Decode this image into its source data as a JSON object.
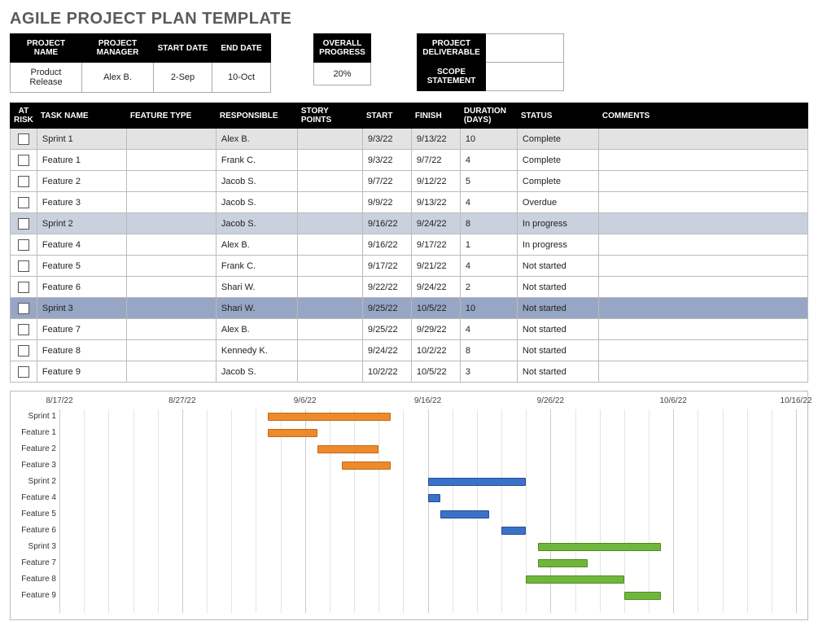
{
  "title": "AGILE PROJECT PLAN TEMPLATE",
  "meta": {
    "labels": {
      "project_name": "PROJECT NAME",
      "project_manager": "PROJECT MANAGER",
      "start_date": "START DATE",
      "end_date": "END DATE",
      "overall_progress": "OVERALL PROGRESS",
      "project_deliverable": "PROJECT DELIVERABLE",
      "scope_statement": "SCOPE STATEMENT"
    },
    "values": {
      "project_name": "Product Release",
      "project_manager": "Alex B.",
      "start_date": "2-Sep",
      "end_date": "10-Oct",
      "overall_progress": "20%",
      "project_deliverable": "",
      "scope_statement": ""
    }
  },
  "columns": {
    "at_risk": "AT RISK",
    "task_name": "TASK NAME",
    "feature_type": "FEATURE TYPE",
    "responsible": "RESPONSIBLE",
    "story_points": "STORY POINTS",
    "start": "START",
    "finish": "FINISH",
    "duration": "DURATION (DAYS)",
    "status": "STATUS",
    "comments": "COMMENTS"
  },
  "rows": [
    {
      "shade": 0,
      "task": "Sprint 1",
      "resp": "Alex B.",
      "start": "9/3/22",
      "finish": "9/13/22",
      "dur": "10",
      "status": "Complete"
    },
    {
      "task": "Feature 1",
      "resp": "Frank C.",
      "start": "9/3/22",
      "finish": "9/7/22",
      "dur": "4",
      "status": "Complete"
    },
    {
      "task": "Feature 2",
      "resp": "Jacob S.",
      "start": "9/7/22",
      "finish": "9/12/22",
      "dur": "5",
      "status": "Complete"
    },
    {
      "task": "Feature 3",
      "resp": "Jacob S.",
      "start": "9/9/22",
      "finish": "9/13/22",
      "dur": "4",
      "status": "Overdue"
    },
    {
      "shade": 1,
      "task": "Sprint 2",
      "resp": "Jacob S.",
      "start": "9/16/22",
      "finish": "9/24/22",
      "dur": "8",
      "status": "In progress"
    },
    {
      "task": "Feature 4",
      "resp": "Alex B.",
      "start": "9/16/22",
      "finish": "9/17/22",
      "dur": "1",
      "status": "In progress"
    },
    {
      "task": "Feature 5",
      "resp": "Frank C.",
      "start": "9/17/22",
      "finish": "9/21/22",
      "dur": "4",
      "status": "Not started"
    },
    {
      "task": "Feature 6",
      "resp": "Shari W.",
      "start": "9/22/22",
      "finish": "9/24/22",
      "dur": "2",
      "status": "Not started"
    },
    {
      "shade": 2,
      "task": "Sprint 3",
      "resp": "Shari W.",
      "start": "9/25/22",
      "finish": "10/5/22",
      "dur": "10",
      "status": "Not started"
    },
    {
      "task": "Feature 7",
      "resp": "Alex B.",
      "start": "9/25/22",
      "finish": "9/29/22",
      "dur": "4",
      "status": "Not started"
    },
    {
      "task": "Feature 8",
      "resp": "Kennedy K.",
      "start": "9/24/22",
      "finish": "10/2/22",
      "dur": "8",
      "status": "Not started"
    },
    {
      "task": "Feature 9",
      "resp": "Jacob S.",
      "start": "10/2/22",
      "finish": "10/5/22",
      "dur": "3",
      "status": "Not started"
    }
  ],
  "chart_data": {
    "type": "gantt",
    "x_axis": {
      "min": "8/17/22",
      "max": "10/16/22",
      "major_ticks": [
        "8/17/22",
        "8/27/22",
        "9/6/22",
        "9/16/22",
        "9/26/22",
        "10/6/22",
        "10/16/22"
      ]
    },
    "series_colors": {
      "sprint1": "orange",
      "sprint2": "blue",
      "sprint3": "green"
    },
    "tasks": [
      {
        "name": "Sprint 1",
        "start": "9/3/22",
        "finish": "9/13/22",
        "color": "orange"
      },
      {
        "name": "Feature 1",
        "start": "9/3/22",
        "finish": "9/7/22",
        "color": "orange"
      },
      {
        "name": "Feature 2",
        "start": "9/7/22",
        "finish": "9/12/22",
        "color": "orange"
      },
      {
        "name": "Feature 3",
        "start": "9/9/22",
        "finish": "9/13/22",
        "color": "orange"
      },
      {
        "name": "Sprint 2",
        "start": "9/16/22",
        "finish": "9/24/22",
        "color": "blue"
      },
      {
        "name": "Feature 4",
        "start": "9/16/22",
        "finish": "9/17/22",
        "color": "blue"
      },
      {
        "name": "Feature 5",
        "start": "9/17/22",
        "finish": "9/21/22",
        "color": "blue"
      },
      {
        "name": "Feature 6",
        "start": "9/22/22",
        "finish": "9/24/22",
        "color": "blue"
      },
      {
        "name": "Sprint 3",
        "start": "9/25/22",
        "finish": "10/5/22",
        "color": "green"
      },
      {
        "name": "Feature 7",
        "start": "9/25/22",
        "finish": "9/29/22",
        "color": "green"
      },
      {
        "name": "Feature 8",
        "start": "9/24/22",
        "finish": "10/2/22",
        "color": "green"
      },
      {
        "name": "Feature 9",
        "start": "10/2/22",
        "finish": "10/5/22",
        "color": "green"
      }
    ]
  }
}
